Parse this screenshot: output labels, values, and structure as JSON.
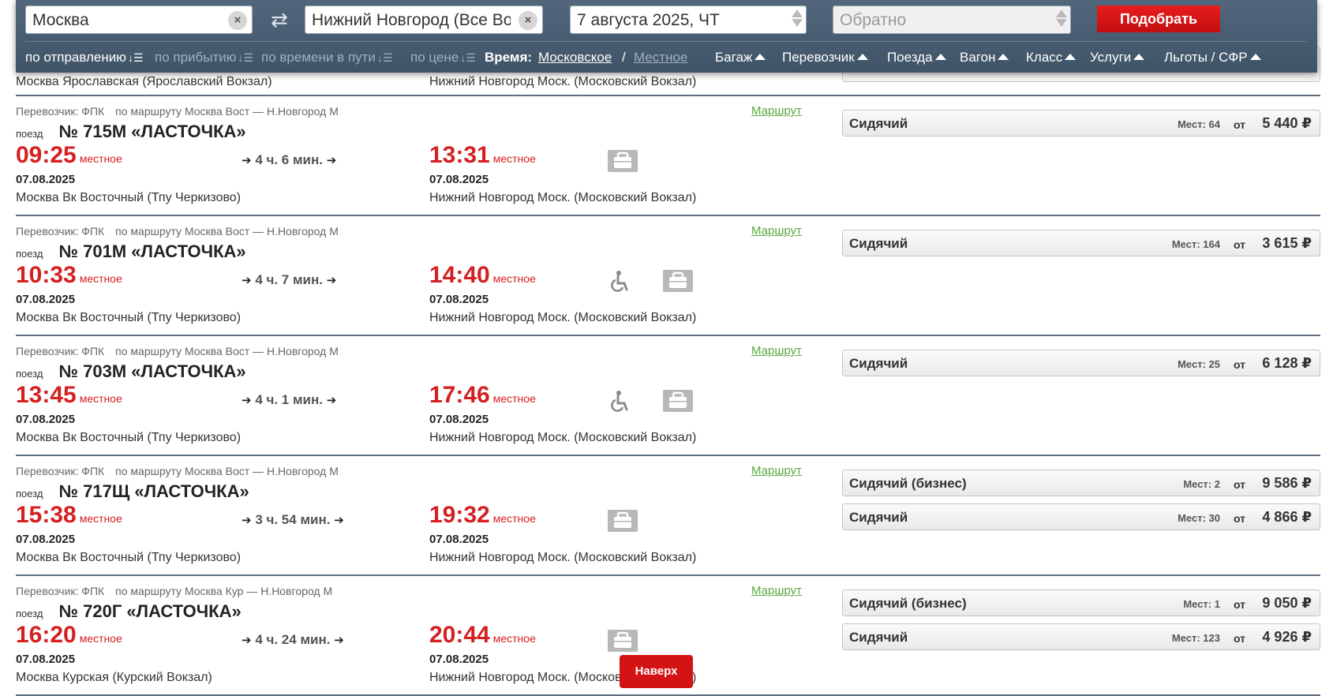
{
  "search": {
    "from_value": "Москва",
    "to_value": "Нижний Новгород (Все Вокзалы)",
    "date_value": "7 августа 2025, ЧТ",
    "return_placeholder": "Обратно",
    "submit_label": "Подобрать",
    "clear_glyph": "×",
    "swap_glyph": "⇄"
  },
  "filters": {
    "sort_departure": "по отправлению",
    "sort_arrival": "по прибытию",
    "sort_travel": "по времени в пути",
    "sort_price": "по цене",
    "sort_glyph": "↓☰",
    "time_label": "Время:",
    "time_moscow": "Московское",
    "time_slash": "/",
    "time_local": "Местное",
    "baggage": "Багаж",
    "carrier": "Перевозчик",
    "trains": "Поезда",
    "wagon": "Вагон",
    "class": "Класс",
    "services": "Услуги",
    "benefits": "Льготы / СФР"
  },
  "partial_row": {
    "dep_station": "Москва Ярославская (Ярославский Вокзал)",
    "arr_station": "Нижний Новгород Моск. (Московский Вокзал)"
  },
  "labels": {
    "carrier_prefix": "Перевозчик: ФПК",
    "train_prefix": "поезд",
    "local": "местное",
    "route_link": "Маршрут",
    "seats_prefix": "Мест:",
    "from": "от",
    "arrow": "➔"
  },
  "trains": [
    {
      "route": "по маршруту Москва Вост — Н.Новгород М",
      "name": "№ 715М «ЛАСТОЧКА»",
      "dep_time": "09:25",
      "arr_time": "13:31",
      "duration": "4 ч. 6 мин.",
      "dep_date": "07.08.2025",
      "arr_date": "07.08.2025",
      "dep_station": "Москва Вк Восточный (Тпу Черкизово)",
      "arr_station": "Нижний Новгород Моск. (Московский Вокзал)",
      "icons": [
        "luggage-icon"
      ],
      "fares": [
        {
          "class": "Сидячий",
          "seats": "64",
          "price": "5 440 ₽"
        }
      ]
    },
    {
      "route": "по маршруту Москва Вост — Н.Новгород М",
      "name": "№ 701М «ЛАСТОЧКА»",
      "dep_time": "10:33",
      "arr_time": "14:40",
      "duration": "4 ч. 7 мин.",
      "dep_date": "07.08.2025",
      "arr_date": "07.08.2025",
      "dep_station": "Москва Вк Восточный (Тпу Черкизово)",
      "arr_station": "Нижний Новгород Моск. (Московский Вокзал)",
      "icons": [
        "wheelchair-icon",
        "luggage-icon"
      ],
      "fares": [
        {
          "class": "Сидячий",
          "seats": "164",
          "price": "3 615 ₽"
        }
      ]
    },
    {
      "route": "по маршруту Москва Вост — Н.Новгород М",
      "name": "№ 703М «ЛАСТОЧКА»",
      "dep_time": "13:45",
      "arr_time": "17:46",
      "duration": "4 ч. 1 мин.",
      "dep_date": "07.08.2025",
      "arr_date": "07.08.2025",
      "dep_station": "Москва Вк Восточный (Тпу Черкизово)",
      "arr_station": "Нижний Новгород Моск. (Московский Вокзал)",
      "icons": [
        "wheelchair-icon",
        "luggage-icon"
      ],
      "fares": [
        {
          "class": "Сидячий",
          "seats": "25",
          "price": "6 128 ₽"
        }
      ]
    },
    {
      "route": "по маршруту Москва Вост — Н.Новгород М",
      "name": "№ 717Щ «ЛАСТОЧКА»",
      "dep_time": "15:38",
      "arr_time": "19:32",
      "duration": "3 ч. 54 мин.",
      "dep_date": "07.08.2025",
      "arr_date": "07.08.2025",
      "dep_station": "Москва Вк Восточный (Тпу Черкизово)",
      "arr_station": "Нижний Новгород Моск. (Московский Вокзал)",
      "icons": [
        "luggage-icon"
      ],
      "fares": [
        {
          "class": "Сидячий (бизнес)",
          "seats": "2",
          "price": "9 586 ₽"
        },
        {
          "class": "Сидячий",
          "seats": "30",
          "price": "4 866 ₽"
        }
      ]
    },
    {
      "route": "по маршруту Москва Кур — Н.Новгород М",
      "name": "№ 720Г «ЛАСТОЧКА»",
      "dep_time": "16:20",
      "arr_time": "20:44",
      "duration": "4 ч. 24 мин.",
      "dep_date": "07.08.2025",
      "arr_date": "07.08.2025",
      "dep_station": "Москва Курская (Курский Вокзал)",
      "arr_station": "Нижний Новгород Моск. (Московский Вокзал)",
      "icons": [
        "luggage-icon"
      ],
      "fares": [
        {
          "class": "Сидячий (бизнес)",
          "seats": "1",
          "price": "9 050 ₽"
        },
        {
          "class": "Сидячий",
          "seats": "123",
          "price": "4 926 ₽"
        }
      ]
    }
  ],
  "scroll_top_label": "Наверх",
  "colors": {
    "accent_red": "#d42020",
    "link_green": "#5aa83e",
    "header_bg": "#4a5f73"
  }
}
